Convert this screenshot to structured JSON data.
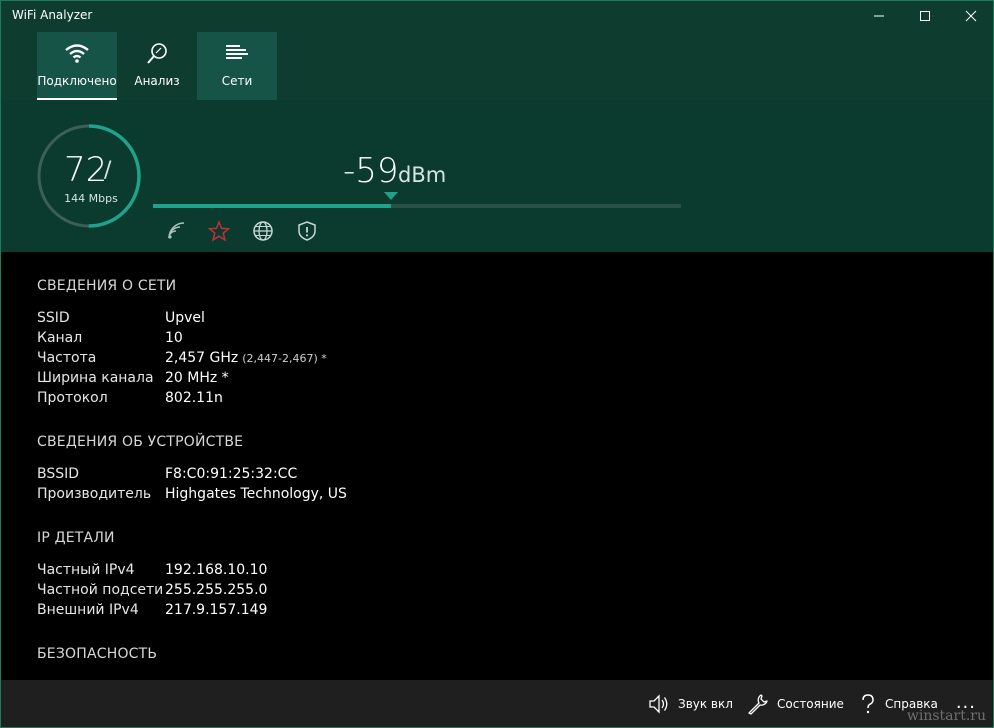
{
  "app": {
    "title": "WiFi Analyzer"
  },
  "nav": {
    "tabs": [
      {
        "label": "Подключено",
        "icon": "wifi-icon",
        "active": true
      },
      {
        "label": "Анализ",
        "icon": "magnifier-icon",
        "active": false
      },
      {
        "label": "Сети",
        "icon": "list-icon",
        "active": false
      }
    ]
  },
  "hero": {
    "speed": "72",
    "speed_slash": "/",
    "speed_max": "144 Mbps",
    "signal_value": "-59",
    "signal_unit": "dBm",
    "signal_fraction": 0.45,
    "link_fraction": 0.5,
    "accent_color": "#1fa18a",
    "status_icons": [
      "wifi-weak-icon",
      "star-icon",
      "globe-icon",
      "shield-icon"
    ],
    "star_color": "#c0303b"
  },
  "network": {
    "heading": "СВЕДЕНИЯ О СЕТИ",
    "rows": [
      {
        "key": "SSID",
        "value": "Upvel",
        "extra": ""
      },
      {
        "key": "Канал",
        "value": "10",
        "extra": ""
      },
      {
        "key": "Частота",
        "value": "2,457 GHz",
        "extra": "(2,447-2,467) *"
      },
      {
        "key": "Ширина канала",
        "value": "20 MHz *",
        "extra": ""
      },
      {
        "key": "Протокол",
        "value": "802.11n",
        "extra": ""
      }
    ]
  },
  "device": {
    "heading": "СВЕДЕНИЯ ОБ УСТРОЙСТВЕ",
    "rows": [
      {
        "key": "BSSID",
        "value": "F8:C0:91:25:32:CC"
      },
      {
        "key": "Производитель",
        "value": "Highgates Technology, US"
      }
    ]
  },
  "ip": {
    "heading": "IP ДЕТАЛИ",
    "rows": [
      {
        "key": "Частный IPv4",
        "value": "192.168.10.10"
      },
      {
        "key": "Частной подсети",
        "value": "255.255.255.0"
      },
      {
        "key": "Внешний IPv4",
        "value": "217.9.157.149"
      }
    ]
  },
  "security": {
    "heading": "БЕЗОПАСНОСТЬ"
  },
  "bottom": {
    "sound_label": "Звук вкл",
    "state_label": "Состояние",
    "help_label": "Справка",
    "more_label": "..."
  },
  "watermark": "winstart.ru"
}
